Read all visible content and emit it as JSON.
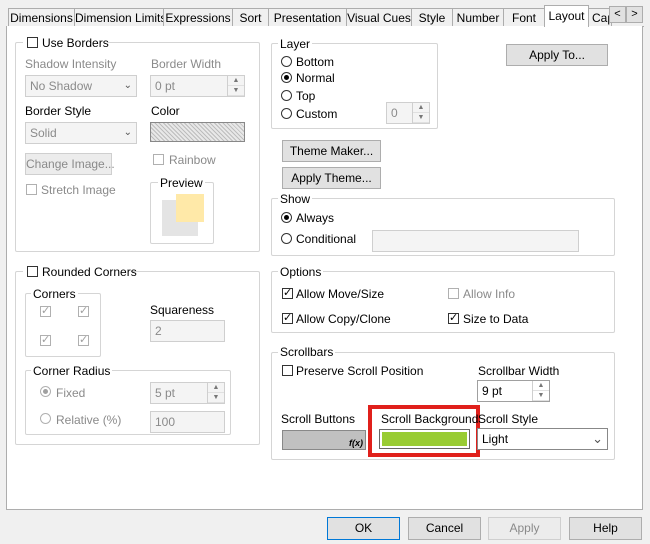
{
  "tabs": [
    "Dimensions",
    "Dimension Limits",
    "Expressions",
    "Sort",
    "Presentation",
    "Visual Cues",
    "Style",
    "Number",
    "Font",
    "Layout",
    "Cap"
  ],
  "active_tab": "Layout",
  "tab_nav": {
    "prev": "<",
    "next": ">",
    "close": "×"
  },
  "borders": {
    "use_borders_label": "Use Borders",
    "use_borders_checked": false,
    "shadow_intensity_label": "Shadow Intensity",
    "shadow_value": "No Shadow",
    "border_width_label": "Border Width",
    "border_width_value": "0 pt",
    "border_style_label": "Border Style",
    "border_style_value": "Solid",
    "color_label": "Color",
    "change_image_label": "Change Image...",
    "rainbow_label": "Rainbow",
    "stretch_image_label": "Stretch Image",
    "preview_label": "Preview"
  },
  "rounded": {
    "rounded_corners_label": "Rounded Corners",
    "corners_label": "Corners",
    "squareness_label": "Squareness",
    "squareness_value": "2",
    "corner_radius_label": "Corner Radius",
    "fixed_label": "Fixed",
    "fixed_value": "5 pt",
    "relative_label": "Relative (%)",
    "relative_value": "100"
  },
  "layer": {
    "title": "Layer",
    "bottom": "Bottom",
    "normal": "Normal",
    "top": "Top",
    "custom": "Custom",
    "custom_value": "0",
    "selected": "Normal"
  },
  "apply_to_label": "Apply To...",
  "theme_maker_label": "Theme Maker...",
  "apply_theme_label": "Apply Theme...",
  "show": {
    "title": "Show",
    "always": "Always",
    "conditional": "Conditional"
  },
  "options": {
    "title": "Options",
    "allow_move_size": "Allow Move/Size",
    "allow_info": "Allow Info",
    "allow_copy_clone": "Allow Copy/Clone",
    "size_to_data": "Size to Data"
  },
  "scrollbars": {
    "title": "Scrollbars",
    "preserve_label": "Preserve Scroll Position",
    "scrollbar_width_label": "Scrollbar Width",
    "scrollbar_width_value": "9 pt",
    "scroll_buttons_label": "Scroll Buttons",
    "scroll_background_label": "Scroll Background",
    "scroll_style_label": "Scroll Style",
    "scroll_style_value": "Light",
    "fx_label": "f(x)",
    "scroll_buttons_color": "#c0c0c0",
    "scroll_background_color": "#99cc33"
  },
  "highlight_color": "#e0201b",
  "footer": {
    "ok": "OK",
    "cancel": "Cancel",
    "apply": "Apply",
    "help": "Help"
  }
}
